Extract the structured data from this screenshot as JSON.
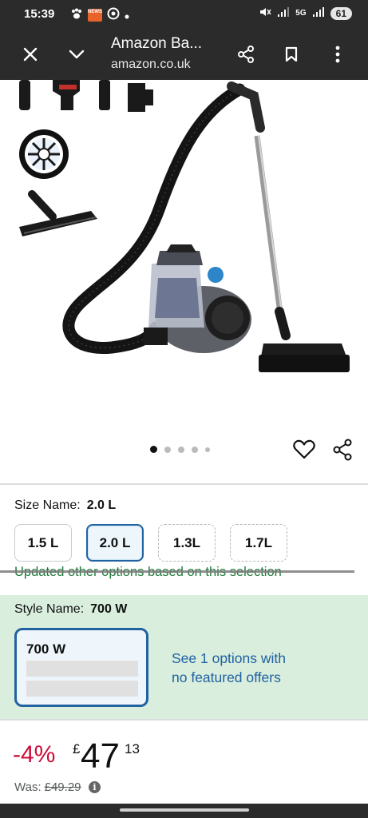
{
  "status_bar": {
    "time": "15:39",
    "news_badge": "NEWS",
    "network_type": "5G",
    "battery": "61"
  },
  "toolbar": {
    "title": "Amazon Ba...",
    "url": "amazon.co.uk"
  },
  "gallery": {
    "image_count": 5,
    "active_index": 0
  },
  "size": {
    "label": "Size Name:",
    "selected": "2.0 L",
    "options": [
      "1.5 L",
      "2.0 L",
      "1.3L",
      "1.7L"
    ],
    "update_notice": "Updated other options based on this selection"
  },
  "style": {
    "label": "Style Name:",
    "selected": "700 W",
    "card_name": "700 W",
    "see_options_line1": "See 1 options with",
    "see_options_line2": "no featured offers"
  },
  "price": {
    "discount": "-4%",
    "currency": "£",
    "whole": "47",
    "fraction": "13",
    "was_label": "Was:",
    "was_price": "£49.29"
  },
  "colors": {
    "bar_bg": "#2b2b2b",
    "accent_blue": "#2162a1",
    "discount_red": "#cc0c39",
    "green_text": "#1f7a3a",
    "style_bg": "#d9eedd"
  }
}
